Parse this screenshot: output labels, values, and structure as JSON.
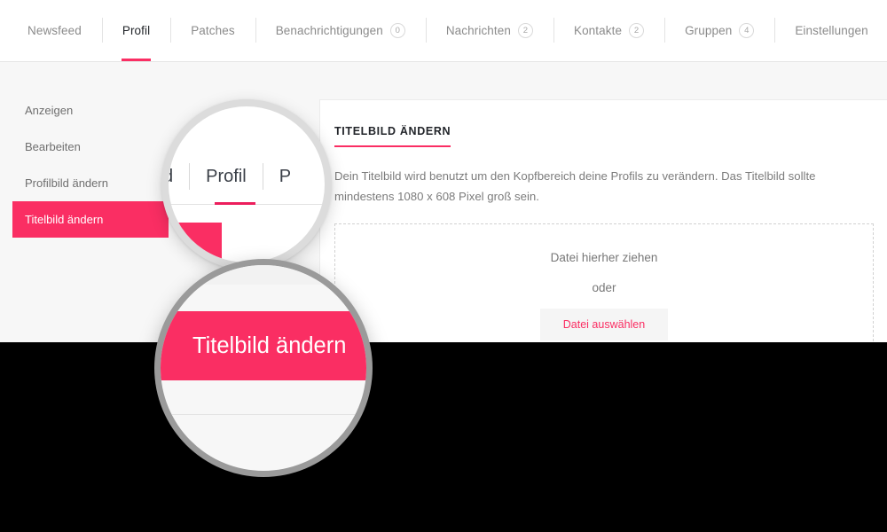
{
  "topnav": {
    "items": [
      {
        "label": "Newsfeed",
        "badge": null,
        "active": false
      },
      {
        "label": "Profil",
        "badge": null,
        "active": true
      },
      {
        "label": "Patches",
        "badge": null,
        "active": false
      },
      {
        "label": "Benachrichtigungen",
        "badge": "0",
        "active": false
      },
      {
        "label": "Nachrichten",
        "badge": "2",
        "active": false
      },
      {
        "label": "Kontakte",
        "badge": "2",
        "active": false
      },
      {
        "label": "Gruppen",
        "badge": "4",
        "active": false
      },
      {
        "label": "Einstellungen",
        "badge": null,
        "active": false
      }
    ]
  },
  "sidebar": {
    "items": [
      {
        "label": "Anzeigen",
        "active": false
      },
      {
        "label": "Bearbeiten",
        "active": false
      },
      {
        "label": "Profilbild ändern",
        "active": false
      },
      {
        "label": "Titelbild ändern",
        "active": true
      }
    ]
  },
  "card": {
    "title": "TITELBILD ÄNDERN",
    "description": "Dein Titelbild wird benutzt um den Kopfbereich deine Profils zu verändern. Das Titelbild sollte mindestens 1080 x 608 Pixel groß sein.",
    "dropzone": {
      "drag_text": "Datei hierher ziehen",
      "or_text": "oder",
      "button_label": "Datei auswählen"
    }
  },
  "magnifier_top": {
    "left_partial_tab": "d",
    "center_tab": "Profil",
    "right_partial_tab": "P"
  },
  "magnifier_bottom": {
    "label": "Titelbild ändern"
  },
  "colors": {
    "accent_pink": "#fa2e63",
    "page_background": "#f7f7f7",
    "card_background": "#ffffff",
    "text_muted": "#7c7c7c",
    "overlay_black": "#000000"
  }
}
